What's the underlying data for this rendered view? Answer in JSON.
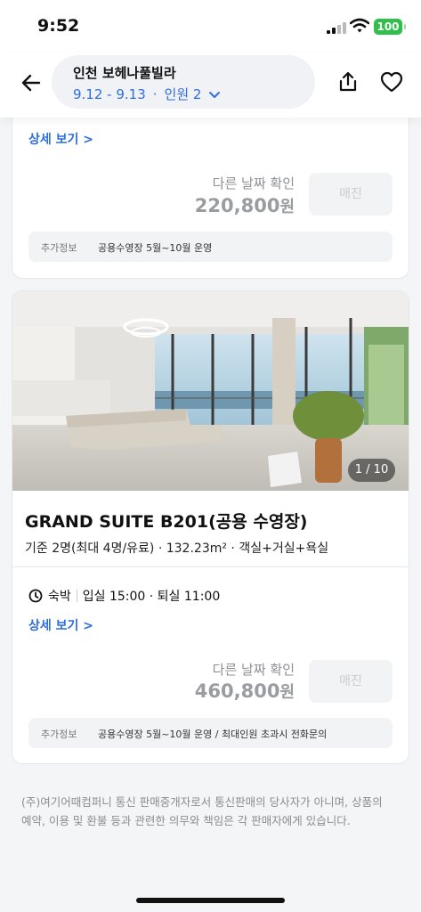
{
  "status_bar": {
    "time": "9:52",
    "battery": "100"
  },
  "header": {
    "title": "인천 보헤나풀빌라",
    "dates": "9.12 - 9.13",
    "separator": "·",
    "guests": "인원 2"
  },
  "room_prev": {
    "detail_link": "상세 보기 >",
    "other_date_label": "다른 날짜 확인",
    "price": "220,800",
    "price_unit": "원",
    "soldout_label": "매진",
    "info_label": "추가정보",
    "info_text": "공용수영장 5월~10월 운영"
  },
  "room_main": {
    "photo_counter": "1 / 10",
    "title": "GRAND SUITE B201(공용 수영장)",
    "specs": "기준 2명(최대 4명/유료) · 132.23m² · 객실+거실+욕실",
    "stay_type": "숙박",
    "checkin_out": "입실 15:00 · 퇴실 11:00",
    "detail_link": "상세 보기 >",
    "other_date_label": "다른 날짜 확인",
    "price": "460,800",
    "price_unit": "원",
    "soldout_label": "매진",
    "info_label": "추가정보",
    "info_text": "공용수영장 5월~10월 운영 / 최대인원 초과시 전화문의"
  },
  "disclaimer": "(주)여기어때컴퍼니 통신 판매중개자로서 통신판매의 당사자가 아니며, 상품의 예약, 이용 및 환불 등과 관련한 의무와 책임은 각 판매자에게 있습니다.",
  "colors": {
    "accent": "#2d6ee0",
    "battery": "#2fbf4a"
  },
  "icons": [
    "back-arrow-icon",
    "chevron-down-icon",
    "share-icon",
    "heart-icon",
    "clock-icon",
    "signal-icon",
    "wifi-icon",
    "battery-icon"
  ]
}
